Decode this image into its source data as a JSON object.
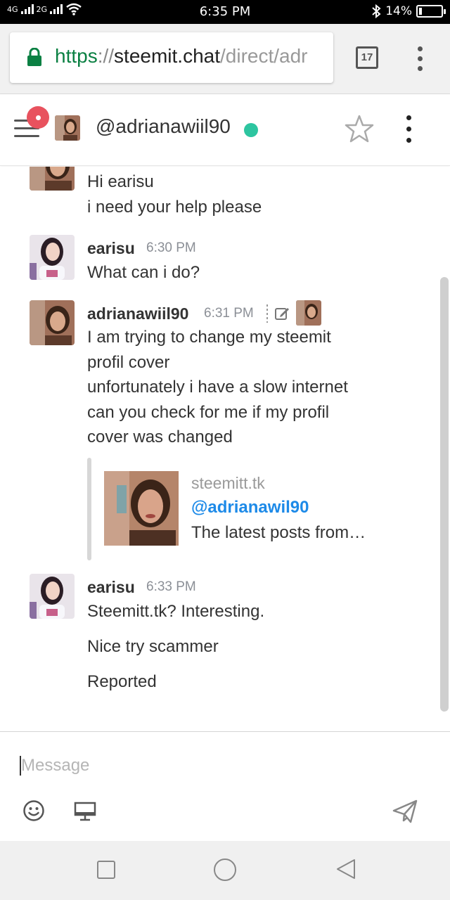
{
  "status_bar": {
    "network_left": "4G",
    "network_right": "2G",
    "time": "6:35 PM",
    "battery": "14%",
    "battery_level": 0.14
  },
  "browser": {
    "url_scheme": "https",
    "url_sep": "://",
    "url_host": "steemit.chat",
    "url_path": "/direct/adr",
    "tab_count": "17"
  },
  "header": {
    "username": "@adrianawiil90",
    "status_color": "#2dc5a0"
  },
  "messages": {
    "m1": {
      "lines": [
        "Hi earisu",
        "i need your help please"
      ]
    },
    "m2": {
      "name": "earisu",
      "time": "6:30 PM",
      "lines": [
        "What can i do?"
      ]
    },
    "m3": {
      "name": "adrianawiil90",
      "time": "6:31 PM",
      "lines": [
        "I am trying to change my steemit",
        "profil cover",
        "unfortunately i have a slow internet",
        "can you check for me if my profil",
        "cover was changed"
      ],
      "preview": {
        "site": "steemitt.tk",
        "title": "@adrianawil90",
        "description": "The latest posts from…"
      }
    },
    "m4": {
      "name": "earisu",
      "time": "6:33 PM",
      "lines": [
        "Steemitt.tk? Interesting.",
        "Nice try scammer",
        "Reported"
      ]
    }
  },
  "composer": {
    "placeholder": "Message"
  },
  "colors": {
    "link": "#1d8ae8",
    "badge": "#e8525e",
    "online": "#2dc5a0",
    "secure": "#0b8043"
  },
  "icons": [
    "lock-icon",
    "star-icon",
    "emoji-icon",
    "screen-share-icon",
    "send-icon",
    "menu-icon",
    "more-vertical-icon"
  ]
}
